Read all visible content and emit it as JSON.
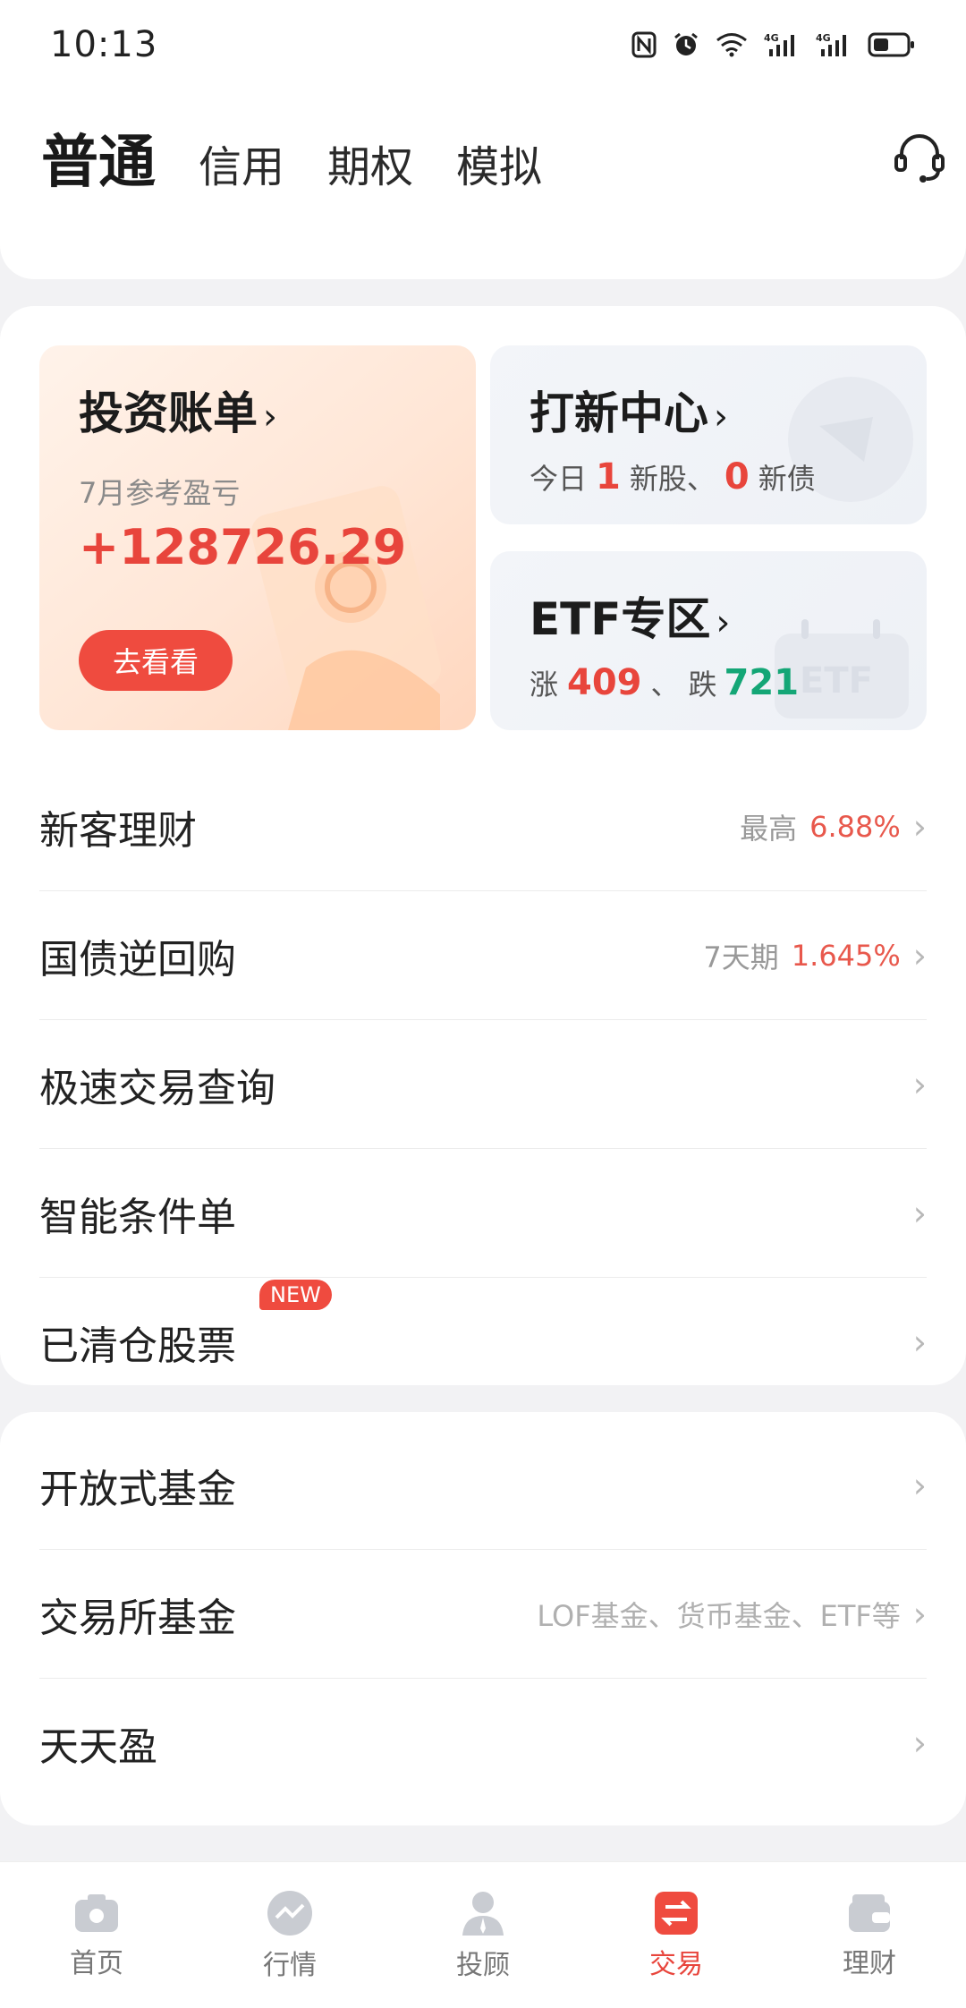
{
  "status": {
    "time": "10:13"
  },
  "header": {
    "tabs": [
      "普通",
      "信用",
      "期权",
      "模拟"
    ]
  },
  "promos": {
    "bill": {
      "title": "投资账单",
      "sub": "7月参考盈亏",
      "amount": "+128726.29",
      "button": "去看看"
    },
    "ipo": {
      "title": "打新中心",
      "prefix": "今日",
      "new_stock_count": "1",
      "new_stock_label": "新股、",
      "new_bond_count": "0",
      "new_bond_label": "新债"
    },
    "etf": {
      "title": "ETF专区",
      "up_label": "涨",
      "up_count": "409",
      "sep": "、",
      "down_label": "跌",
      "down_count": "721"
    }
  },
  "list1": [
    {
      "label": "新客理财",
      "hint": "最高",
      "value": "6.88%"
    },
    {
      "label": "国债逆回购",
      "hint": "7天期",
      "value": "1.645%"
    },
    {
      "label": "极速交易查询",
      "hint": "",
      "value": ""
    },
    {
      "label": "智能条件单",
      "hint": "",
      "value": ""
    },
    {
      "label": "已清仓股票",
      "hint": "",
      "value": "",
      "badge": "NEW"
    }
  ],
  "list2": [
    {
      "label": "开放式基金",
      "hint": ""
    },
    {
      "label": "交易所基金",
      "hint": "LOF基金、货币基金、ETF等"
    },
    {
      "label": "天天盈",
      "hint": ""
    }
  ],
  "nav": [
    {
      "label": "首页",
      "icon": "home-icon"
    },
    {
      "label": "行情",
      "icon": "market-icon"
    },
    {
      "label": "投顾",
      "icon": "advisor-icon"
    },
    {
      "label": "交易",
      "icon": "trade-icon"
    },
    {
      "label": "理财",
      "icon": "wallet-icon"
    }
  ],
  "colors": {
    "accent": "#e8453c",
    "up": "#e8453c",
    "down": "#14a676"
  }
}
